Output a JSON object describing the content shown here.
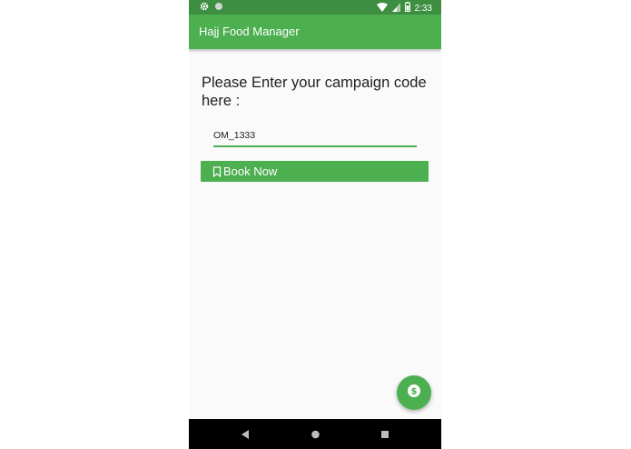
{
  "status_bar": {
    "time": "2:33",
    "icons": [
      "settings-icon",
      "circle-icon",
      "wifi-icon",
      "cell-signal-icon",
      "battery-icon"
    ]
  },
  "app_bar": {
    "title": "Hajj Food Manager",
    "color": "#4caf50"
  },
  "main": {
    "prompt": "Please Enter your campaign code here :",
    "code_input": {
      "value": "OM_1333"
    },
    "book_button": {
      "label": "Book Now",
      "icon": "bookmark-icon"
    }
  },
  "fab": {
    "icon": "dollar-icon"
  },
  "nav_bar": {
    "buttons": [
      "back-icon",
      "home-icon",
      "recents-icon"
    ]
  },
  "colors": {
    "accent": "#4caf50",
    "status_bar": "#3e8e41"
  }
}
